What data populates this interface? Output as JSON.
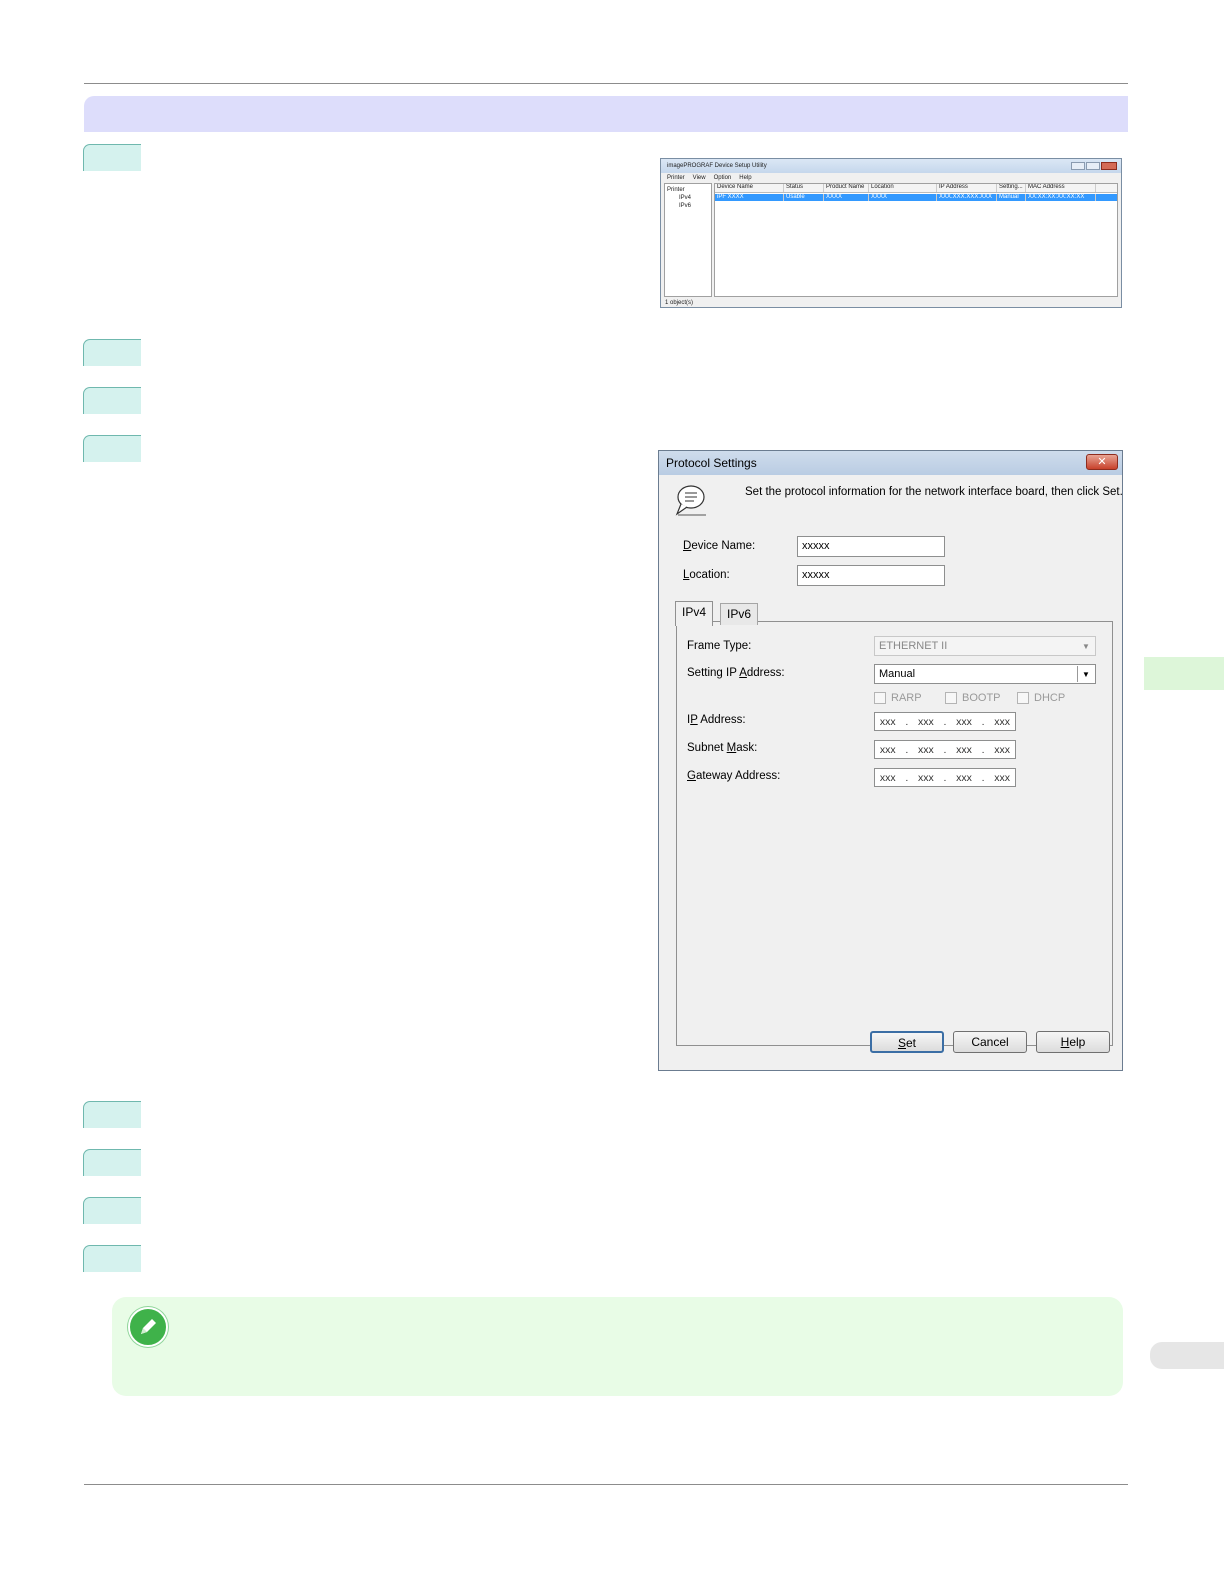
{
  "utility_window": {
    "title": "imagePROGRAF Device Setup Utility",
    "menu": [
      "Printer",
      "View",
      "Option",
      "Help"
    ],
    "tree": [
      "Printer",
      "IPv4",
      "IPv6"
    ],
    "columns": [
      "Device Name",
      "Status",
      "Product Name",
      "Location",
      "IP Address",
      "Setting...",
      "MAC Address"
    ],
    "row": [
      "iPF XXXX",
      "Usable",
      "XXXX",
      "XXXX",
      "XXX.XXX.XXX.XXX",
      "Manual",
      "XX:XX:XX:XX:XX:XX"
    ],
    "status_bar": "1 object(s)"
  },
  "dialog": {
    "title": "Protocol Settings",
    "close_glyph": "✕",
    "description": "Set the protocol information for the network interface board, then click Set.",
    "device_name": {
      "label_u": "D",
      "label_rest": "evice Name:",
      "value": "xxxxx"
    },
    "location": {
      "label_u": "L",
      "label_rest": "ocation:",
      "value": "xxxxx"
    },
    "tabs": [
      "IPv4",
      "IPv6"
    ],
    "frame_type": {
      "label": "Frame Type:",
      "value": "ETHERNET II"
    },
    "setting_ip": {
      "label_a": "Setting IP ",
      "label_u": "A",
      "label_b": "ddress:",
      "value": "Manual"
    },
    "checkboxes": [
      "RARP",
      "BOOTP",
      "DHCP"
    ],
    "ip_address": {
      "label_a": "I",
      "label_u": "P",
      "label_b": " Address:",
      "octets": [
        "xxx",
        "xxx",
        "xxx",
        "xxx"
      ]
    },
    "subnet_mask": {
      "label_a": "Subnet ",
      "label_u": "M",
      "label_b": "ask:",
      "octets": [
        "xxx",
        "xxx",
        "xxx",
        "xxx"
      ]
    },
    "gateway": {
      "label_u": "G",
      "label_b": "ateway Address:",
      "octets": [
        "xxx",
        "xxx",
        "xxx",
        "xxx"
      ]
    },
    "buttons": {
      "set_u": "S",
      "set_rest": "et",
      "cancel": "Cancel",
      "help_u": "H",
      "help_rest": "elp"
    }
  }
}
